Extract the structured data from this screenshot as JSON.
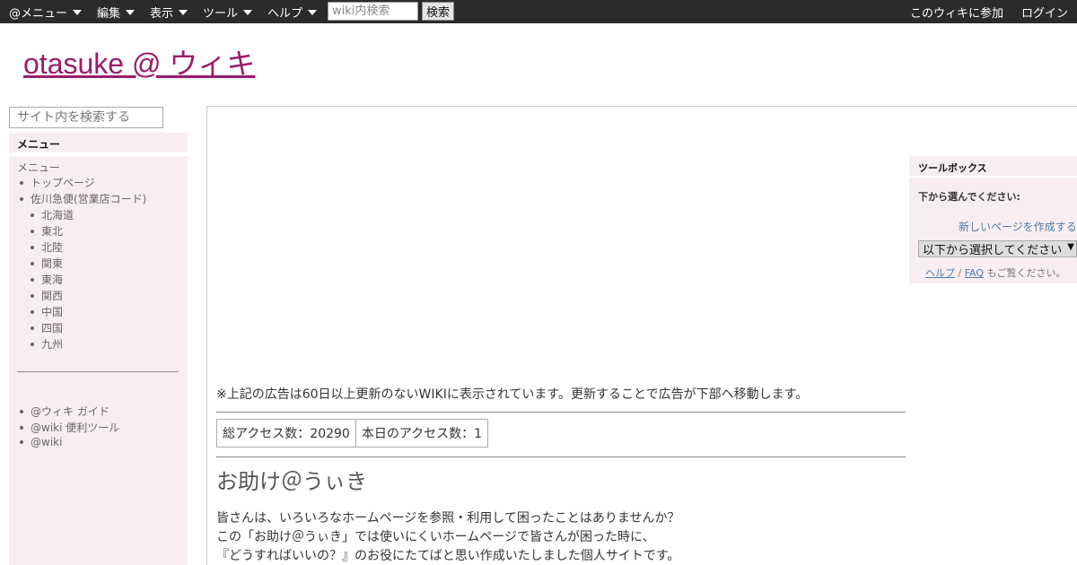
{
  "topbar": {
    "menus": [
      {
        "label": "@メニュー"
      },
      {
        "label": "編集"
      },
      {
        "label": "表示"
      },
      {
        "label": "ツール"
      },
      {
        "label": "ヘルプ"
      }
    ],
    "search_placeholder": "wiki内検索",
    "search_button": "検索",
    "join_link": "このウィキに参加",
    "login_link": "ログイン"
  },
  "site_title": "otasuke @ ウィキ",
  "sidebar": {
    "search_placeholder": "サイト内を検索する",
    "menu_header": "メニュー",
    "menu_label": "メニュー",
    "items": [
      "トップページ",
      "佐川急便(営業店コード)"
    ],
    "sub_items": [
      "北海道",
      "東北",
      "北陸",
      "関東",
      "東海",
      "関西",
      "中国",
      "四国",
      "九州"
    ],
    "footer_items": [
      "@ウィキ ガイド",
      "@wiki 便利ツール",
      "@wiki"
    ]
  },
  "main": {
    "ad_note": "※上記の広告は60日以上更新のないWIKIに表示されています。更新することで広告が下部へ移動します。",
    "total_access": "総アクセス数：20290",
    "today_access": "本日のアクセス数：1",
    "heading": "お助け＠うぃき",
    "intro": [
      "皆さんは、いろいろなホームページを参照・利用して困ったことはありませんか？",
      "この「お助け＠うぃき」では使いにくいホームページで皆さんが困った時に、",
      "『どうすればいいの？』のお役にたてばと思い作成いたしました個人サイトです。"
    ]
  },
  "toolbox": {
    "header": "ツールボックス",
    "prompt": "下から選んでください:",
    "new_page": "新しいページを作成する",
    "select_value": "以下から選択してください",
    "help": "ヘルプ",
    "sep": "/",
    "faq": "FAQ",
    "help_tail": "もご覧ください。"
  },
  "colors": {
    "topbar": "#2b2b2b",
    "title": "#9b1b6b",
    "sidebar_bg": "#f8eef1",
    "link": "#4a7ab0"
  }
}
